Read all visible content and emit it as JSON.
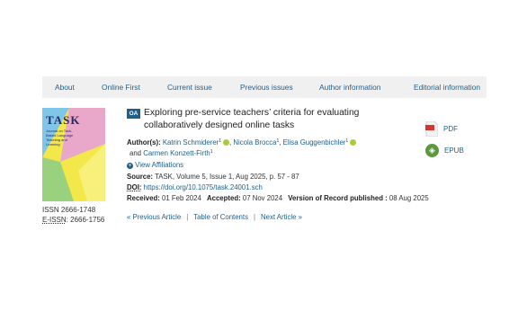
{
  "nav": {
    "items": [
      "About",
      "Online First",
      "Current issue",
      "Previous issues",
      "Author information",
      "Editorial information"
    ]
  },
  "cover": {
    "journal": "TASK",
    "subtitle": "Journal on Task-Based Language Teaching and Learning"
  },
  "issn": {
    "print": "ISSN 2666-1748",
    "eissn_label": "E-ISSN",
    "eissn_value": ": 2666-1756"
  },
  "article": {
    "oa_badge": "OA",
    "title": "Exploring pre-service teachers’ criteria for evaluating collaboratively designed online tasks",
    "authors_label": "Author(s):",
    "authors": [
      "Katrin Schmiderer",
      "Nicola Brocca",
      "Elisa Guggenbichler",
      "Carmen Konzett-Firth"
    ],
    "affil_sup": "1",
    "view_affiliations": "View Affiliations",
    "source_label": "Source:",
    "source_value": "TASK, Volume 5, Issue 1, Aug 2025, p. 57 - 87",
    "doi_label": "DOI:",
    "doi_value": "https://doi.org/10.1075/task.24001.sch",
    "received_label": "Received:",
    "received_value": "01 Feb 2024",
    "accepted_label": "Accepted:",
    "accepted_value": "07 Nov 2024",
    "vor_label": "Version of Record published :",
    "vor_value": "08 Aug 2025"
  },
  "pagination": {
    "prev": "« Previous Article",
    "toc": "Table of Contents",
    "next": "Next Article »"
  },
  "downloads": {
    "pdf": "PDF",
    "epub": "EPUB"
  },
  "colors": {
    "link": "#1f5f8b",
    "orcid": "#a6ce39",
    "oa_badge": "#1f5f8b"
  }
}
